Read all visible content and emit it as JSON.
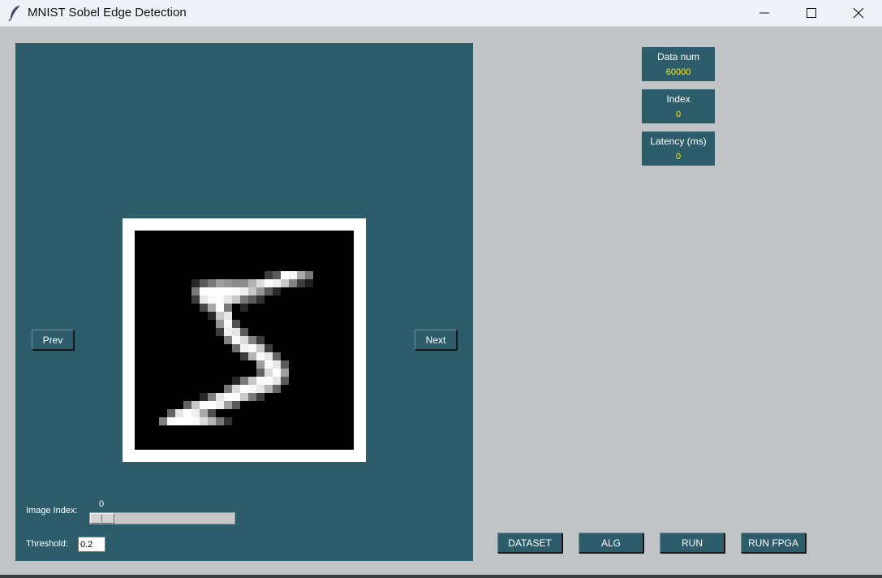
{
  "window": {
    "title": "MNIST Sobel Edge Detection",
    "icons": [
      "feather-icon",
      "minimize-icon",
      "maximize-icon",
      "close-icon"
    ]
  },
  "colors": {
    "background": "#c0c4c7",
    "panel": "#2d5c6b",
    "value_text": "#ffea00"
  },
  "viewer": {
    "prev_label": "Prev",
    "next_label": "Next",
    "image_index_label": "Image Index:",
    "image_index_value": "0",
    "slider_fraction": 0,
    "threshold_label": "Threshold:",
    "threshold_value": "0.2"
  },
  "stats": {
    "data_num_label": "Data num",
    "data_num_value": "60000",
    "index_label": "Index",
    "index_value": "0",
    "latency_label": "Latency (ms)",
    "latency_value": "0"
  },
  "actions": {
    "dataset_label": "DATASET",
    "alg_label": "ALG",
    "run_label": "RUN",
    "run_fpga_label": "RUN FPGA"
  }
}
